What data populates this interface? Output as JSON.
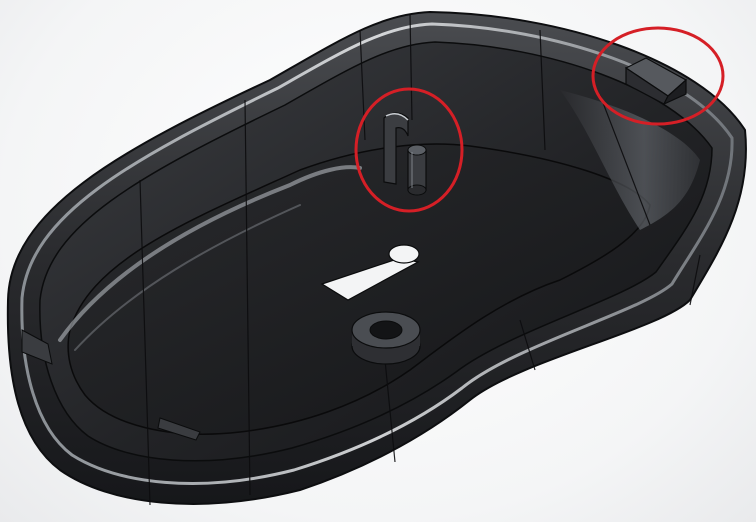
{
  "scene": {
    "subject": "cad-model-render",
    "background_color": "#ffffff",
    "shell_color": "#2a2b2e",
    "floor_color": "#1e1f21",
    "highlight_color": "#cfd3d8",
    "annotation_color": "#d51f26",
    "annotations": [
      {
        "name": "clip-feature-highlight"
      },
      {
        "name": "boss-feature-highlight"
      }
    ]
  }
}
